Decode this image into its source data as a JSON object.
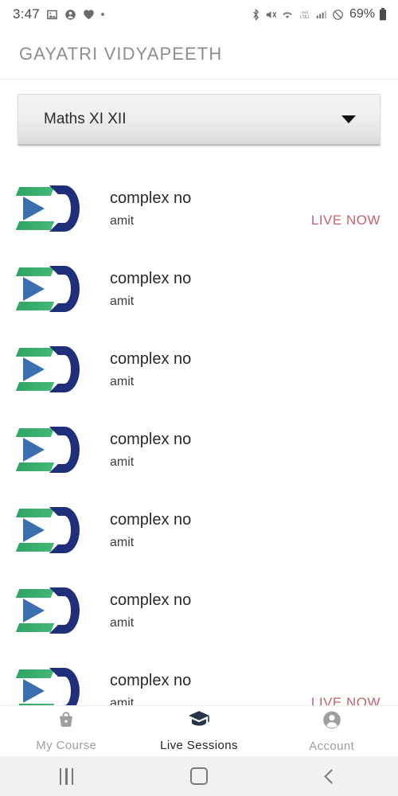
{
  "status_bar": {
    "time": "3:47",
    "left_icons": [
      "image-icon",
      "contact-icon",
      "heart-icon",
      "dot-icon"
    ],
    "right_icons": [
      "bluetooth-icon",
      "mute-icon",
      "wifi-icon",
      "volte-icon",
      "signal-icon",
      "dnd-icon"
    ],
    "volte_label": "VoLTE1",
    "battery_percent": "69%"
  },
  "header": {
    "title": "GAYATRI VIDYAPEETH"
  },
  "course_selector": {
    "selected": "Maths XI XII",
    "icon": "chevron-down-icon"
  },
  "sessions": [
    {
      "title": "complex no",
      "teacher": "amit",
      "status": "LIVE NOW"
    },
    {
      "title": "complex no",
      "teacher": "amit",
      "status": ""
    },
    {
      "title": "complex no",
      "teacher": "amit",
      "status": ""
    },
    {
      "title": "complex no",
      "teacher": "amit",
      "status": ""
    },
    {
      "title": "complex no",
      "teacher": "amit",
      "status": ""
    },
    {
      "title": "complex no",
      "teacher": "amit",
      "status": ""
    },
    {
      "title": "complex no",
      "teacher": "amit",
      "status": "LIVE NOW"
    }
  ],
  "bottom_nav": [
    {
      "label": "My Course",
      "icon": "basket-icon",
      "active": false
    },
    {
      "label": "Live Sessions",
      "icon": "graduation-cap-icon",
      "active": true
    },
    {
      "label": "Account",
      "icon": "person-circle-icon",
      "active": false
    }
  ],
  "system_nav": {
    "recents": "recents-icon",
    "home": "home-icon",
    "back": "back-icon"
  },
  "colors": {
    "live_now": "#c4636c",
    "active_nav": "#20262e",
    "inactive_nav": "#9e9e9e",
    "header_text": "#8e8e8e",
    "logo_green": "#2fa463",
    "logo_navy": "#1f2f7a"
  }
}
